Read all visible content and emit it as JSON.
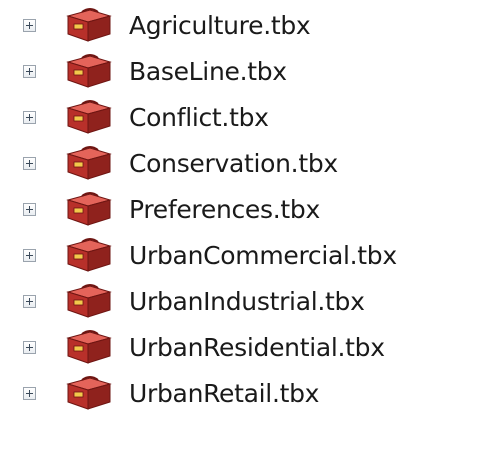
{
  "tree": {
    "items": [
      {
        "label": "Agriculture.tbx",
        "icon": "toolbox-icon"
      },
      {
        "label": "BaseLine.tbx",
        "icon": "toolbox-icon"
      },
      {
        "label": "Conflict.tbx",
        "icon": "toolbox-icon"
      },
      {
        "label": "Conservation.tbx",
        "icon": "toolbox-icon"
      },
      {
        "label": "Preferences.tbx",
        "icon": "toolbox-icon"
      },
      {
        "label": "UrbanCommercial.tbx",
        "icon": "toolbox-icon"
      },
      {
        "label": "UrbanIndustrial.tbx",
        "icon": "toolbox-icon"
      },
      {
        "label": "UrbanResidential.tbx",
        "icon": "toolbox-icon"
      },
      {
        "label": "UrbanRetail.tbx",
        "icon": "toolbox-icon"
      }
    ]
  },
  "colors": {
    "toolbox_red": "#b8302a",
    "toolbox_dark": "#6e1512",
    "toolbox_light": "#e4645a",
    "expander_border": "#9aa3ad"
  }
}
